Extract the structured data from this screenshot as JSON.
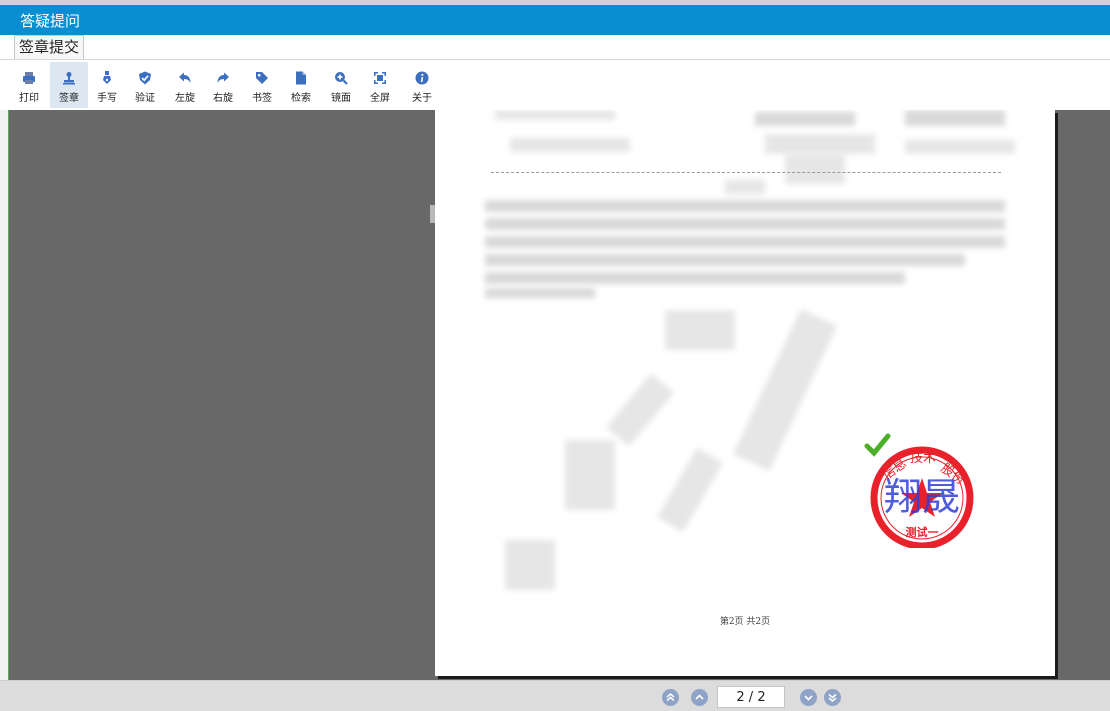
{
  "window": {
    "title": "答疑提问"
  },
  "menu": {
    "items": [
      {
        "label": "签章提交"
      }
    ]
  },
  "toolbar": {
    "buttons": [
      {
        "label": "打印",
        "icon": "printer-icon"
      },
      {
        "label": "签章",
        "icon": "stamp-icon"
      },
      {
        "label": "手写",
        "icon": "pen-icon"
      },
      {
        "label": "验证",
        "icon": "shield-check-icon"
      },
      {
        "label": "左旋",
        "icon": "rotate-left-icon"
      },
      {
        "label": "右旋",
        "icon": "rotate-right-icon"
      },
      {
        "label": "书签",
        "icon": "bookmark-tag-icon"
      },
      {
        "label": "检索",
        "icon": "search-document-icon"
      },
      {
        "label": "镜面",
        "icon": "zoom-in-icon"
      },
      {
        "label": "全屏",
        "icon": "fullscreen-icon"
      },
      {
        "label": "关于",
        "icon": "info-icon"
      }
    ],
    "active_button": "签章"
  },
  "document": {
    "footer": "第2页  共2页",
    "seal": {
      "bottom_text": "测试一",
      "signature": "翔晟",
      "color": "#e8212b",
      "signature_color": "#2f3fd6",
      "check_color": "#4caf2a"
    }
  },
  "pager": {
    "page_display": "2 / 2",
    "current": 2,
    "total": 2
  },
  "colors": {
    "titlebar": "#0a8ed2",
    "viewer_bg": "#686868",
    "nav_button": "#8fa3c7"
  }
}
